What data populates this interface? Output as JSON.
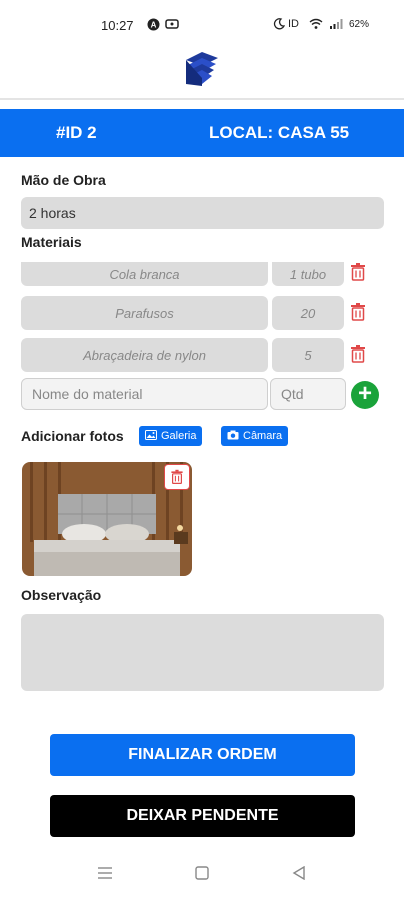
{
  "status_bar": {
    "time": "10:27",
    "battery": "62%",
    "left_icons": [
      "a-circle-icon",
      "infinity-icon"
    ],
    "right_icons": [
      "moon-icon",
      "id-icon",
      "wifi-icon",
      "signal-icon"
    ]
  },
  "header": {
    "logo": "app-logo"
  },
  "banner": {
    "id_text": "#ID 2",
    "local_text": "LOCAL: CASA 55",
    "color": "#0a6ff0"
  },
  "labor": {
    "label": "Mão de Obra",
    "value": "2 horas"
  },
  "materials": {
    "label": "Materiais",
    "items": [
      {
        "name": "Cola branca",
        "qty": "1 tubo"
      },
      {
        "name": "Parafusos",
        "qty": "20"
      },
      {
        "name": "Abraçadeira de nylon",
        "qty": "5"
      }
    ],
    "name_placeholder": "Nome do material",
    "qty_placeholder": "Qtd"
  },
  "photos": {
    "label": "Adicionar fotos",
    "gallery_label": "Galeria",
    "camera_label": "Câmara"
  },
  "observation": {
    "label": "Observação",
    "value": ""
  },
  "actions": {
    "finalize_label": "FINALIZAR ORDEM",
    "pending_label": "DEIXAR PENDENTE"
  },
  "nav_bar": {
    "icons": [
      "menu-icon",
      "home-square-icon",
      "back-triangle-icon"
    ]
  },
  "colors": {
    "primary": "#0a6ff0",
    "danger": "#e04848",
    "success": "#1aa33a"
  }
}
